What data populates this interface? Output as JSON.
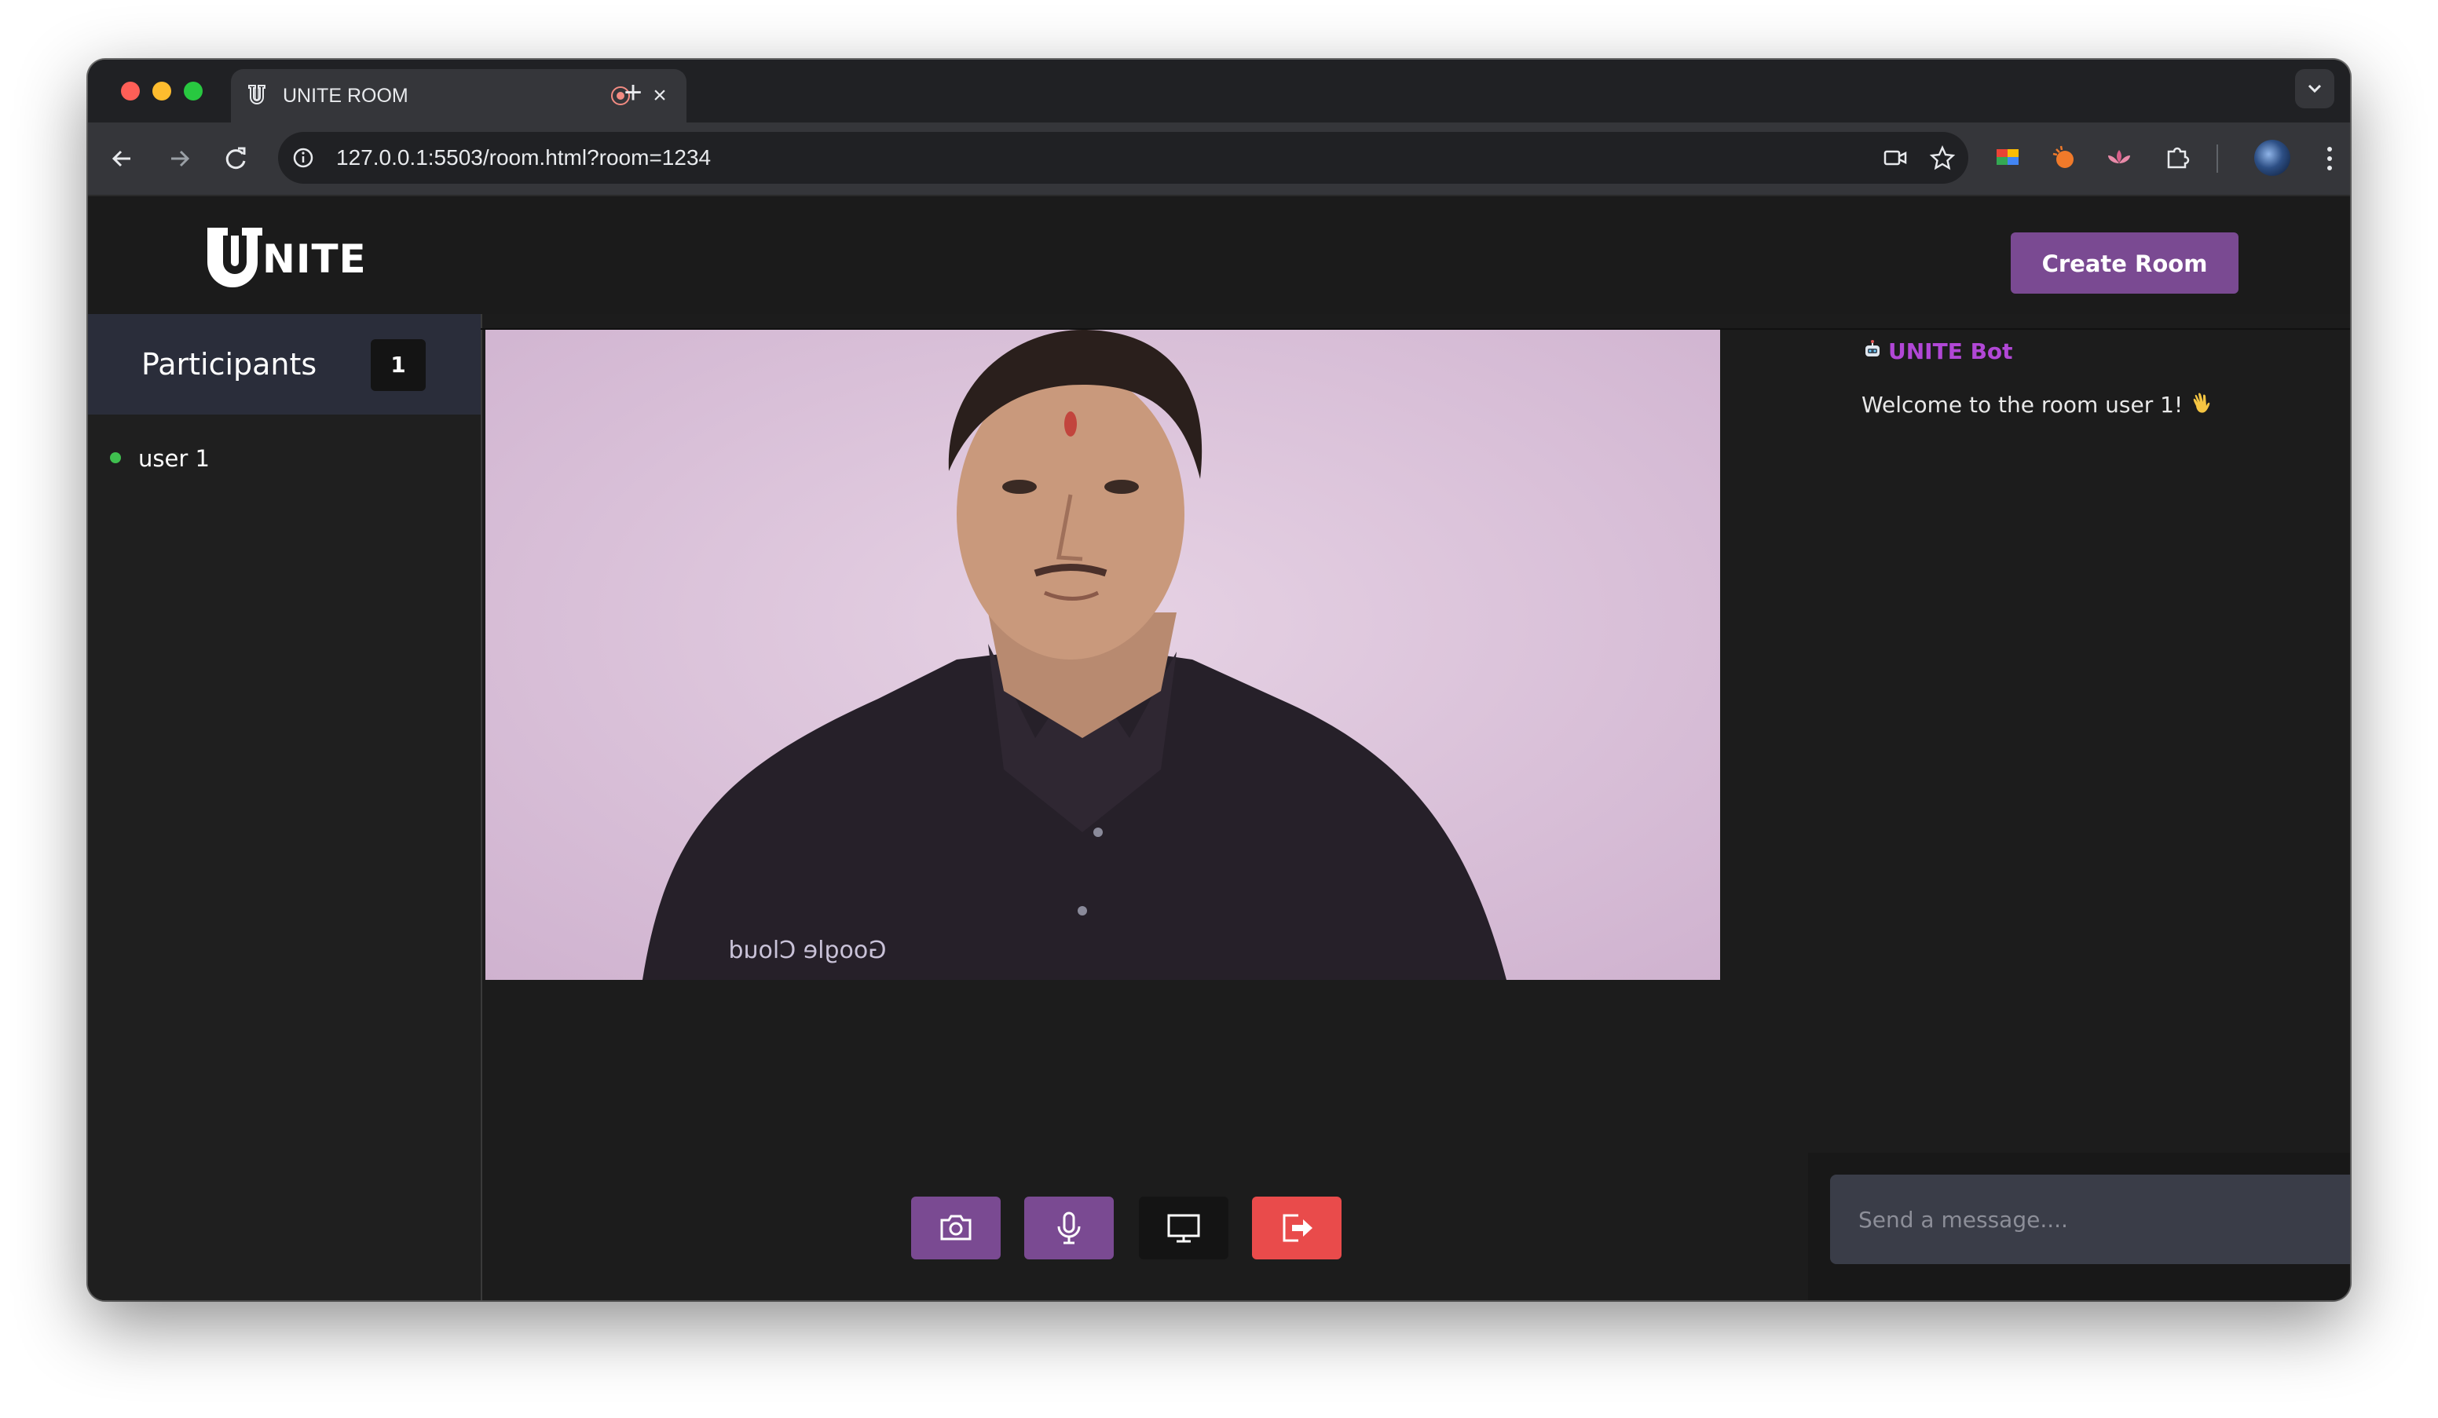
{
  "browser": {
    "tab_title": "UNITE ROOM",
    "url": "127.0.0.1:5503/room.html?room=1234",
    "icons": [
      "close-icon",
      "new-tab-icon",
      "back-icon",
      "forward-icon",
      "reload-icon",
      "site-info-icon",
      "camera-in-use-icon",
      "bookmark-star-icon",
      "extensions-icon",
      "more-menu-icon"
    ]
  },
  "header": {
    "logo_text": "NITE",
    "create_room_label": "Create Room"
  },
  "participants": {
    "title": "Participants",
    "count": "1",
    "list": [
      {
        "name": "user 1",
        "status": "online"
      }
    ]
  },
  "chat": {
    "messages": [
      {
        "author": "UNITE Bot",
        "text": "Welcome to the room user 1!"
      }
    ],
    "input_placeholder": "Send a message...."
  },
  "controls": [
    {
      "name": "camera",
      "icon": "camera-icon"
    },
    {
      "name": "microphone",
      "icon": "microphone-icon"
    },
    {
      "name": "screen-share",
      "icon": "monitor-icon"
    },
    {
      "name": "leave",
      "icon": "leave-icon"
    }
  ],
  "colors": {
    "accent": "#7a4a92",
    "leave": "#e94b4b",
    "bot_name": "#b147d6",
    "online": "#3fbf4f"
  }
}
